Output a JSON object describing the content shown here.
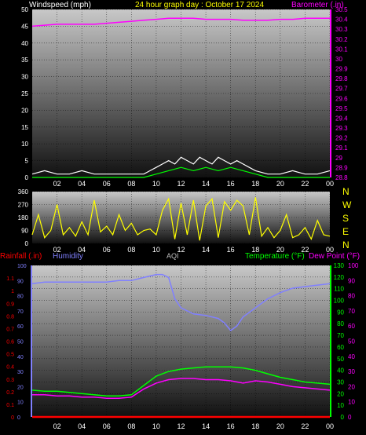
{
  "header": {
    "wind_label": "Windspeed (mph)",
    "title": "24 hour graph day : October 17 2024",
    "baro_label": "Barometer (.in)"
  },
  "bottom_header": {
    "rain_label": "Rainfall (.in)",
    "humidity_label": "Humidity",
    "aqi_label": "AQI",
    "temp_label": "Temperature (°F)",
    "dew_label": "Dew Point (°F)"
  },
  "compass": [
    "N",
    "W",
    "S",
    "E",
    "N"
  ],
  "colors": {
    "wind_title": "#ffffff",
    "title": "#ffff00",
    "baro": "#ff00ff",
    "wind_avg": "#ffffff",
    "gust": "#00ff00",
    "direction": "#ffff00",
    "rain": "#ff0000",
    "humidity": "#8080ff",
    "aqi": "#c0c0c0",
    "temperature": "#00ff00",
    "dew_point": "#ff00ff",
    "compass": "#ffff00"
  },
  "chart_data": [
    {
      "type": "line",
      "panel": "wind_baro",
      "x_ticks": [
        "02",
        "04",
        "06",
        "08",
        "10",
        "12",
        "14",
        "16",
        "18",
        "20",
        "22",
        "00"
      ],
      "y_left": {
        "label": "Windspeed (mph)",
        "ylim": [
          0,
          50
        ],
        "ticks": [
          "0",
          "5",
          "10",
          "15",
          "20",
          "25",
          "30",
          "35",
          "40",
          "45",
          "50"
        ]
      },
      "y_right": {
        "label": "Barometer (.in)",
        "ylim": [
          28.8,
          30.5
        ],
        "ticks": [
          "28.8",
          "28.9",
          "29",
          "29.1",
          "29.2",
          "29.3",
          "29.4",
          "29.5",
          "29.6",
          "29.7",
          "29.8",
          "29.9",
          "30",
          "30.1",
          "30.2",
          "30.3",
          "30.4",
          "30.5"
        ]
      },
      "series": [
        {
          "name": "Barometer",
          "axis": "right",
          "color": "#ff00ff",
          "x": [
            0,
            1,
            2,
            3,
            4,
            5,
            6,
            7,
            8,
            9,
            10,
            11,
            12,
            13,
            14,
            15,
            16,
            17,
            18,
            19,
            20,
            21,
            22,
            23,
            24
          ],
          "y": [
            30.33,
            30.34,
            30.35,
            30.35,
            30.35,
            30.35,
            30.36,
            30.37,
            30.38,
            30.39,
            30.4,
            30.41,
            30.41,
            30.41,
            30.4,
            30.4,
            30.4,
            30.39,
            30.39,
            30.39,
            30.4,
            30.4,
            30.41,
            30.41,
            30.41
          ]
        },
        {
          "name": "Windspeed",
          "axis": "left",
          "color": "#ffffff",
          "x": [
            0,
            1,
            2,
            3,
            4,
            5,
            6,
            7,
            8,
            9,
            9.5,
            10,
            10.5,
            11,
            11.5,
            12,
            12.5,
            13,
            13.5,
            14,
            14.5,
            15,
            15.5,
            16,
            16.5,
            17,
            17.5,
            18,
            19,
            20,
            21,
            22,
            23,
            24
          ],
          "y": [
            1,
            2,
            1,
            1,
            2,
            1,
            1,
            1,
            1,
            1,
            2,
            3,
            4,
            5,
            4,
            6,
            5,
            4,
            6,
            5,
            4,
            6,
            5,
            4,
            5,
            4,
            3,
            2,
            1,
            1,
            2,
            1,
            1,
            2
          ]
        },
        {
          "name": "Gust",
          "axis": "left",
          "color": "#00ff00",
          "x": [
            0,
            2,
            4,
            6,
            8,
            9,
            10,
            11,
            12,
            13,
            14,
            15,
            16,
            17,
            18,
            19,
            20,
            22,
            24
          ],
          "y": [
            0,
            0,
            0,
            0,
            0,
            0,
            1,
            2,
            3,
            2,
            3,
            2,
            3,
            2,
            1,
            0,
            0,
            0,
            0
          ]
        }
      ]
    },
    {
      "type": "line",
      "panel": "wind_direction",
      "x_ticks": [
        "02",
        "04",
        "06",
        "08",
        "10",
        "12",
        "14",
        "16",
        "18",
        "20",
        "22",
        "00"
      ],
      "y_left": {
        "ylim": [
          0,
          360
        ],
        "ticks": [
          "0",
          "90",
          "180",
          "270",
          "360"
        ]
      },
      "series": [
        {
          "name": "Wind Direction",
          "color": "#ffff00",
          "x": [
            0,
            0.5,
            1,
            1.5,
            2,
            2.5,
            3,
            3.5,
            4,
            4.5,
            5,
            5.5,
            6,
            6.5,
            7,
            7.5,
            8,
            8.5,
            9,
            9.5,
            10,
            10.5,
            11,
            11.5,
            12,
            12.5,
            13,
            13.5,
            14,
            14.5,
            15,
            15.5,
            16,
            16.5,
            17,
            17.5,
            18,
            18.5,
            19,
            19.5,
            20,
            20.5,
            21,
            21.5,
            22,
            22.5,
            23,
            23.5,
            24
          ],
          "y": [
            60,
            200,
            40,
            90,
            270,
            60,
            110,
            50,
            150,
            60,
            300,
            80,
            120,
            60,
            200,
            90,
            140,
            60,
            90,
            100,
            60,
            230,
            310,
            30,
            280,
            60,
            300,
            20,
            260,
            310,
            40,
            290,
            230,
            300,
            260,
            60,
            320,
            50,
            110,
            40,
            90,
            200,
            40,
            60,
            110,
            30,
            160,
            60,
            50
          ]
        }
      ]
    },
    {
      "type": "line",
      "panel": "rain_humidity_temp",
      "x_ticks": [
        "02",
        "04",
        "06",
        "08",
        "10",
        "12",
        "14",
        "16",
        "18",
        "20",
        "22",
        "00"
      ],
      "y_rain": {
        "label": "Rainfall (.in)",
        "ylim": [
          0,
          1.2
        ],
        "ticks": [
          "0",
          "0.1",
          "0.2",
          "0.3",
          "0.4",
          "0.5",
          "0.6",
          "0.7",
          "0.8",
          "0.9",
          "1",
          "1.1"
        ]
      },
      "y_humidity": {
        "label": "Humidity",
        "ylim": [
          0,
          100
        ],
        "ticks": [
          "0",
          "10",
          "20",
          "30",
          "40",
          "50",
          "60",
          "70",
          "80",
          "90",
          "100"
        ]
      },
      "y_temp": {
        "label": "Temperature (°F)",
        "ylim": [
          0,
          130
        ],
        "ticks": [
          "0",
          "10",
          "20",
          "30",
          "40",
          "50",
          "60",
          "70",
          "80",
          "90",
          "100",
          "110",
          "120",
          "130"
        ]
      },
      "y_dew": {
        "label": "Dew Point (°F)",
        "ylim": [
          0,
          100
        ],
        "ticks": [
          "0",
          "10",
          "20",
          "30",
          "40",
          "50",
          "60",
          "70",
          "80",
          "90",
          "100"
        ]
      },
      "series": [
        {
          "name": "Humidity",
          "axis": "humidity",
          "color": "#8080ff",
          "x": [
            0,
            1,
            2,
            3,
            4,
            5,
            6,
            7,
            8,
            9,
            10,
            10.5,
            11,
            11.5,
            12,
            13,
            14,
            15,
            15.5,
            16,
            16.5,
            17,
            18,
            19,
            20,
            21,
            22,
            23,
            24
          ],
          "y": [
            88,
            89,
            89,
            89,
            89,
            89,
            89,
            90,
            90,
            92,
            94,
            94,
            92,
            78,
            72,
            68,
            67,
            65,
            62,
            57,
            60,
            66,
            72,
            78,
            82,
            85,
            86,
            87,
            88
          ]
        },
        {
          "name": "Temperature",
          "axis": "temp",
          "color": "#00ff00",
          "x": [
            0,
            1,
            2,
            3,
            4,
            5,
            6,
            7,
            8,
            9,
            10,
            11,
            12,
            13,
            14,
            15,
            16,
            17,
            18,
            19,
            20,
            21,
            22,
            23,
            24
          ],
          "y": [
            23,
            22,
            22,
            21,
            20,
            19,
            18,
            18,
            19,
            27,
            35,
            39,
            41,
            42,
            43,
            43,
            43,
            42,
            40,
            37,
            34,
            32,
            30,
            29,
            28
          ]
        },
        {
          "name": "Dew Point",
          "axis": "temp",
          "color": "#ff00ff",
          "x": [
            0,
            1,
            2,
            3,
            4,
            5,
            6,
            7,
            8,
            9,
            10,
            11,
            12,
            13,
            14,
            15,
            16,
            17,
            18,
            19,
            20,
            21,
            22,
            23,
            24
          ],
          "y": [
            19,
            19,
            18,
            18,
            17,
            17,
            16,
            16,
            17,
            24,
            29,
            32,
            33,
            33,
            32,
            32,
            31,
            29,
            31,
            30,
            28,
            26,
            25,
            24,
            23
          ]
        },
        {
          "name": "Rainfall",
          "axis": "rain",
          "color": "#ff0000",
          "x": [
            0,
            24
          ],
          "y": [
            0,
            0
          ]
        }
      ]
    }
  ]
}
